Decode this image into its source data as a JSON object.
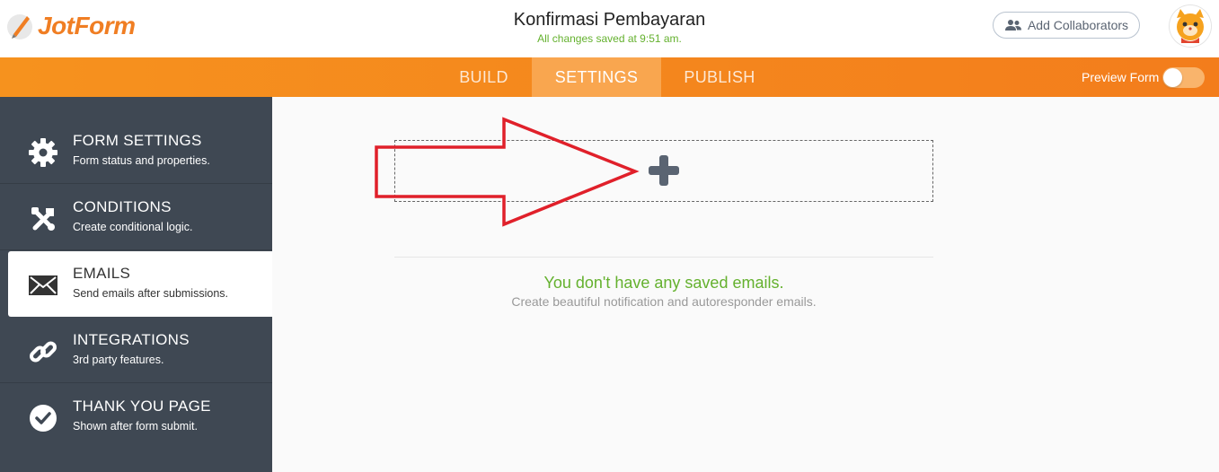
{
  "header": {
    "logo_text": "JotForm",
    "form_title": "Konfirmasi Pembayaran",
    "save_status": "All changes saved at 9:51 am.",
    "collab_label": "Add Collaborators"
  },
  "nav": {
    "tabs": [
      {
        "label": "BUILD",
        "active": false
      },
      {
        "label": "SETTINGS",
        "active": true
      },
      {
        "label": "PUBLISH",
        "active": false
      }
    ],
    "preview_label": "Preview Form",
    "preview_enabled": false
  },
  "sidebar": {
    "items": [
      {
        "label": "FORM SETTINGS",
        "sub": "Form status and properties.",
        "icon": "gear-icon",
        "active": false
      },
      {
        "label": "CONDITIONS",
        "sub": "Create conditional logic.",
        "icon": "tools-icon",
        "active": false
      },
      {
        "label": "EMAILS",
        "sub": "Send emails after submissions.",
        "icon": "envelope-icon",
        "active": true
      },
      {
        "label": "INTEGRATIONS",
        "sub": "3rd party features.",
        "icon": "link-icon",
        "active": false
      },
      {
        "label": "THANK YOU PAGE",
        "sub": "Shown after form submit.",
        "icon": "check-circle-icon",
        "active": false
      }
    ]
  },
  "main": {
    "empty_title": "You don't have any saved emails.",
    "empty_sub": "Create beautiful notification and autoresponder emails."
  },
  "colors": {
    "brand_orange": "#f6921e",
    "sidebar_bg": "#3f4853",
    "success_green": "#64b12e",
    "annotation_red": "#e0202a"
  }
}
